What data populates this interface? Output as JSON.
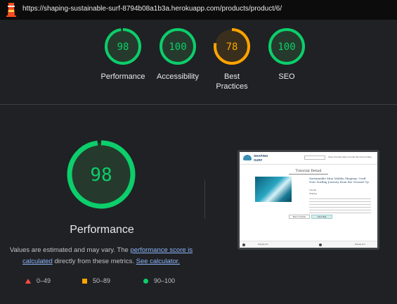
{
  "topbar": {
    "url": "https://shaping-sustainable-surf-8794b08a1b3a.herokuapp.com/products/product/6/"
  },
  "colors": {
    "pass": "#0cce6b",
    "average": "#ffa400",
    "fail": "#ff4e42",
    "pass_text": "#0cce6b",
    "average_text": "#ffa400"
  },
  "summary": [
    {
      "label": "Performance",
      "score": "98",
      "value": 98,
      "rating": "pass"
    },
    {
      "label": "Accessibility",
      "score": "100",
      "value": 100,
      "rating": "pass"
    },
    {
      "label": "Best Practices",
      "score": "78",
      "value": 78,
      "rating": "average"
    },
    {
      "label": "SEO",
      "score": "100",
      "value": 100,
      "rating": "pass"
    }
  ],
  "detail": {
    "score": "98",
    "value": 98,
    "title": "Performance",
    "desc_prefix": "Values are estimated and may vary. The ",
    "link_score": "performance score is calculated",
    "desc_middle": " directly from these metrics. ",
    "link_calc": "See calculator."
  },
  "legend": [
    {
      "icon": "triangle-icon",
      "range": "0–49"
    },
    {
      "icon": "square-icon",
      "range": "50–89"
    },
    {
      "icon": "circle-icon",
      "range": "90–100"
    }
  ],
  "screenshot": {
    "brand_line1": "SHAPING",
    "brand_line2": "SURF",
    "nav_links": "Shop  Tutorials  About  Contact  My Account  Bag",
    "heading": "Tutorial Detail",
    "product_title": "Sustainable Mini Malibu Shaping: Craft Your Surfing Journey from the Ground Up",
    "meta_1": "Tutorial",
    "meta_2": "Shaping",
    "btn_back": "Back to Tutorials",
    "btn_add": "Add to Bag",
    "footer_text": "Shaping Surf"
  }
}
